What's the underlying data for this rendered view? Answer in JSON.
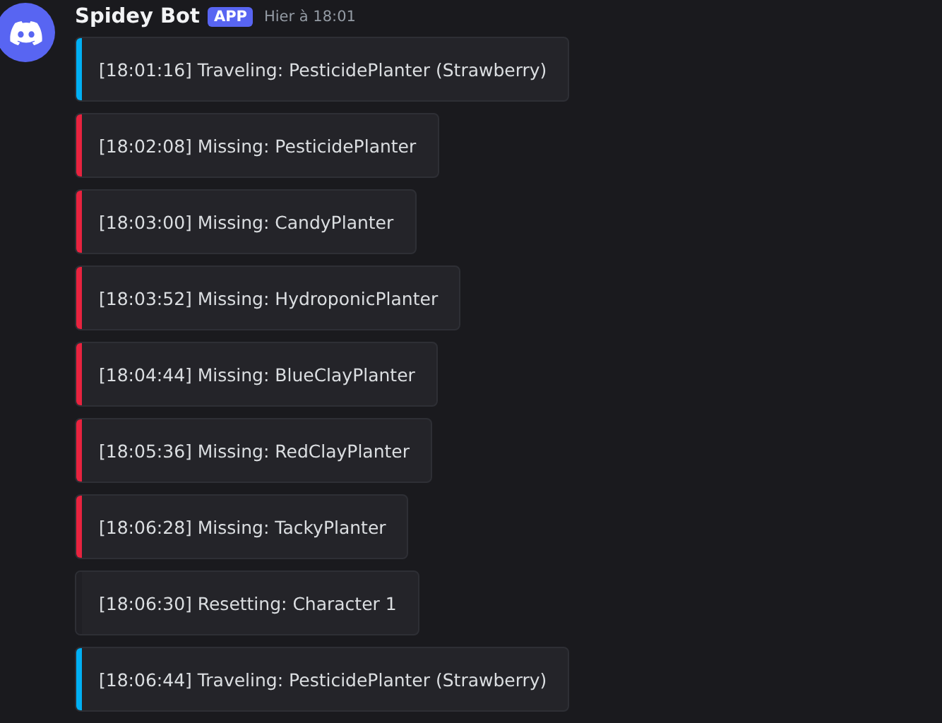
{
  "message": {
    "author": "Spidey Bot",
    "badge": "APP",
    "timestamp": "Hier à 18:01"
  },
  "embeds": [
    {
      "text": "[18:01:16] Traveling: PesticidePlanter (Strawberry)",
      "color": "#00b0f4"
    },
    {
      "text": "[18:02:08] Missing: PesticidePlanter",
      "color": "#e8233f"
    },
    {
      "text": "[18:03:00] Missing: CandyPlanter",
      "color": "#e8233f"
    },
    {
      "text": "[18:03:52] Missing: HydroponicPlanter",
      "color": "#e8233f"
    },
    {
      "text": "[18:04:44] Missing: BlueClayPlanter",
      "color": "#e8233f"
    },
    {
      "text": "[18:05:36] Missing: RedClayPlanter",
      "color": "#e8233f"
    },
    {
      "text": "[18:06:28] Missing: TackyPlanter",
      "color": "#e8233f"
    },
    {
      "text": "[18:06:30] Resetting: Character 1",
      "color": "#202025"
    },
    {
      "text": "[18:06:44] Traveling: PesticidePlanter (Strawberry)",
      "color": "#00b0f4"
    }
  ]
}
